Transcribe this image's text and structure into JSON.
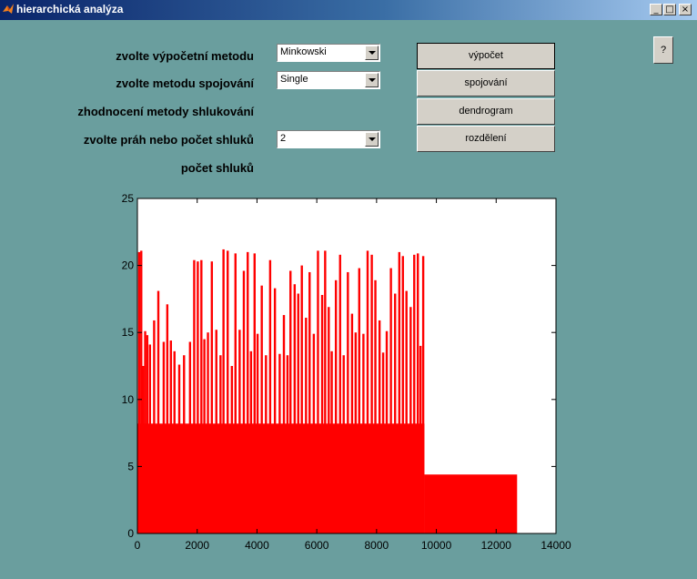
{
  "window": {
    "title": "hierarchická analýza",
    "buttons": {
      "minimize": "_",
      "maximize": "□",
      "close": "×"
    }
  },
  "form": {
    "method_label": "zvolte výpočetní metodu",
    "method_value": "Minkowski",
    "linkage_label": "zvolte metodu spojování",
    "linkage_value": "Single",
    "evaluation_label": "zhodnocení metody shlukování",
    "threshold_label": "zvolte práh nebo počet shluků",
    "threshold_value": "2",
    "clusters_label": "počet shluků"
  },
  "buttons": {
    "compute": "výpočet",
    "linkage": "spojování",
    "dendrogram": "dendrogram",
    "split": "rozdělení",
    "help": "?"
  },
  "chart_data": {
    "type": "bar",
    "xlim": [
      0,
      14000
    ],
    "ylim": [
      0,
      25
    ],
    "x_ticks": [
      0,
      2000,
      4000,
      6000,
      8000,
      10000,
      12000,
      14000
    ],
    "y_ticks": [
      0,
      5,
      10,
      15,
      20,
      25
    ],
    "bar_color": "#ff0000",
    "base_level": 8.2,
    "tail_level": 4.4,
    "tail_range": [
      9600,
      12700
    ],
    "data_end": 9600,
    "spikes": [
      {
        "x": 60,
        "y": 21.0
      },
      {
        "x": 130,
        "y": 21.1
      },
      {
        "x": 190,
        "y": 12.5
      },
      {
        "x": 260,
        "y": 15.1
      },
      {
        "x": 330,
        "y": 14.8
      },
      {
        "x": 420,
        "y": 14.1
      },
      {
        "x": 560,
        "y": 15.9
      },
      {
        "x": 700,
        "y": 18.1
      },
      {
        "x": 880,
        "y": 14.3
      },
      {
        "x": 1000,
        "y": 17.1
      },
      {
        "x": 1120,
        "y": 14.4
      },
      {
        "x": 1240,
        "y": 13.6
      },
      {
        "x": 1400,
        "y": 12.6
      },
      {
        "x": 1560,
        "y": 13.3
      },
      {
        "x": 1760,
        "y": 14.3
      },
      {
        "x": 1900,
        "y": 20.4
      },
      {
        "x": 2020,
        "y": 20.3
      },
      {
        "x": 2140,
        "y": 20.4
      },
      {
        "x": 2240,
        "y": 14.5
      },
      {
        "x": 2360,
        "y": 15.0
      },
      {
        "x": 2490,
        "y": 20.3
      },
      {
        "x": 2640,
        "y": 15.2
      },
      {
        "x": 2780,
        "y": 13.3
      },
      {
        "x": 2880,
        "y": 21.2
      },
      {
        "x": 3020,
        "y": 21.1
      },
      {
        "x": 3160,
        "y": 12.5
      },
      {
        "x": 3280,
        "y": 20.9
      },
      {
        "x": 3420,
        "y": 15.2
      },
      {
        "x": 3560,
        "y": 19.6
      },
      {
        "x": 3690,
        "y": 21.0
      },
      {
        "x": 3800,
        "y": 13.6
      },
      {
        "x": 3920,
        "y": 20.9
      },
      {
        "x": 4020,
        "y": 14.9
      },
      {
        "x": 4160,
        "y": 18.5
      },
      {
        "x": 4300,
        "y": 13.3
      },
      {
        "x": 4440,
        "y": 20.4
      },
      {
        "x": 4600,
        "y": 18.3
      },
      {
        "x": 4760,
        "y": 13.4
      },
      {
        "x": 4900,
        "y": 16.3
      },
      {
        "x": 5020,
        "y": 13.3
      },
      {
        "x": 5120,
        "y": 19.6
      },
      {
        "x": 5260,
        "y": 18.6
      },
      {
        "x": 5380,
        "y": 17.9
      },
      {
        "x": 5500,
        "y": 20.0
      },
      {
        "x": 5640,
        "y": 16.1
      },
      {
        "x": 5760,
        "y": 19.5
      },
      {
        "x": 5900,
        "y": 14.9
      },
      {
        "x": 6040,
        "y": 21.1
      },
      {
        "x": 6180,
        "y": 17.8
      },
      {
        "x": 6280,
        "y": 21.1
      },
      {
        "x": 6400,
        "y": 16.9
      },
      {
        "x": 6500,
        "y": 13.6
      },
      {
        "x": 6640,
        "y": 18.9
      },
      {
        "x": 6780,
        "y": 20.8
      },
      {
        "x": 6900,
        "y": 13.3
      },
      {
        "x": 7040,
        "y": 19.5
      },
      {
        "x": 7180,
        "y": 16.4
      },
      {
        "x": 7300,
        "y": 15.0
      },
      {
        "x": 7420,
        "y": 19.8
      },
      {
        "x": 7560,
        "y": 14.9
      },
      {
        "x": 7700,
        "y": 21.1
      },
      {
        "x": 7840,
        "y": 20.8
      },
      {
        "x": 7960,
        "y": 18.9
      },
      {
        "x": 8100,
        "y": 15.9
      },
      {
        "x": 8220,
        "y": 13.5
      },
      {
        "x": 8340,
        "y": 15.1
      },
      {
        "x": 8480,
        "y": 19.8
      },
      {
        "x": 8620,
        "y": 17.9
      },
      {
        "x": 8760,
        "y": 21.0
      },
      {
        "x": 8880,
        "y": 20.7
      },
      {
        "x": 9000,
        "y": 18.1
      },
      {
        "x": 9140,
        "y": 16.9
      },
      {
        "x": 9260,
        "y": 20.8
      },
      {
        "x": 9380,
        "y": 20.9
      },
      {
        "x": 9470,
        "y": 14.0
      },
      {
        "x": 9560,
        "y": 20.7
      }
    ]
  }
}
